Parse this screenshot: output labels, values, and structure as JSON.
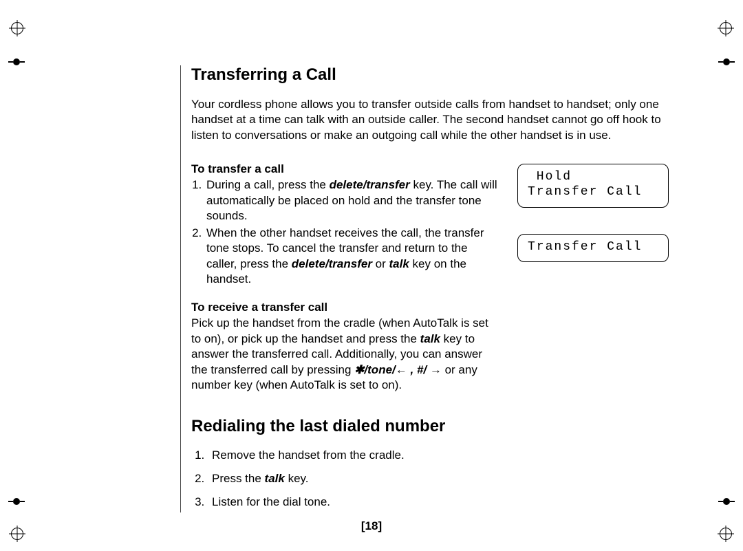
{
  "sections": {
    "transfer": {
      "title": "Transferring a Call",
      "intro": "Your cordless phone allows you to transfer outside calls from handset to handset; only one handset at a time can talk with an outside caller. The second handset cannot go off hook to listen to conversations or make an outgoing call while the other handset is in use.",
      "sub_a_title": "To transfer a call",
      "step1_pre": "During a call, press the ",
      "step1_key": "delete/transfer",
      "step1_post": " key. The call will automatically be placed on hold and the transfer tone sounds.",
      "step2_pre": "When the other handset receives the call, the transfer tone stops. To cancel the transfer and return to the caller, press the ",
      "step2_key1": "delete/transfer",
      "step2_mid": " or ",
      "step2_key2": "talk",
      "step2_post": " key on the handset.",
      "sub_b_title": "To receive a transfer call",
      "recv_pre": "Pick up the handset from the cradle (when AutoTalk is set to on), or pick up the handset and press the ",
      "recv_key": "talk",
      "recv_mid": " key to answer the transferred call. Additionally, you can answer the transferred call by pressing ",
      "recv_key2": "/tone/",
      "recv_mid2": " , ",
      "recv_key3": "#/",
      "recv_post": " or any number key (when AutoTalk is set to on)."
    },
    "redial": {
      "title": "Redialing the last dialed number",
      "steps": {
        "s1": "Remove the handset from the cradle.",
        "s2_pre": "Press the ",
        "s2_key": "talk",
        "s2_post": " key.",
        "s3": "Listen for the dial tone."
      }
    }
  },
  "lcd": {
    "box1_line1": " Hold",
    "box1_line2": "Transfer Call",
    "box2_line1": "Transfer Call"
  },
  "glyphs": {
    "star": "✱",
    "arrow_left": "←",
    "arrow_right": "→"
  },
  "page_number": "[18]"
}
